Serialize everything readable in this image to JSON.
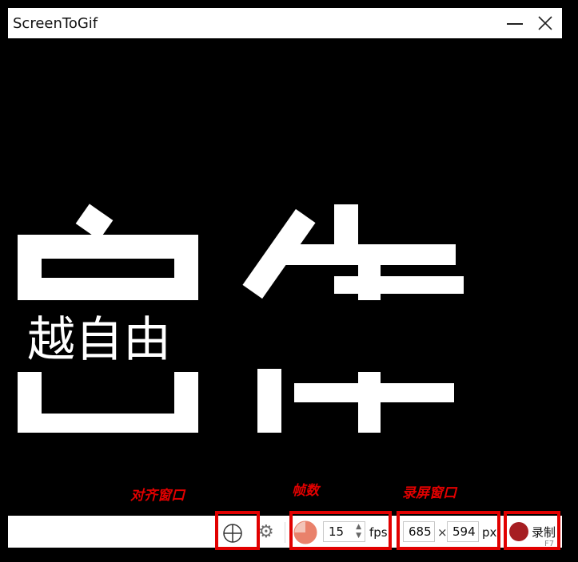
{
  "window": {
    "title": "ScreenToGif"
  },
  "capture": {
    "overlay_text": "越自由"
  },
  "toolbar": {
    "fps_value": "15",
    "fps_unit": "fps",
    "width_value": "685",
    "times": "×",
    "height_value": "594",
    "px_unit": "px",
    "record_label": "录制",
    "record_hotkey": "F7"
  },
  "annotations": {
    "snap_window": "对齐窗口",
    "frame_rate": "帧数",
    "capture_window": "录屏窗口"
  },
  "colors": {
    "annotation": "#e10000",
    "record": "#a61e22",
    "dial": "#e9816b"
  }
}
